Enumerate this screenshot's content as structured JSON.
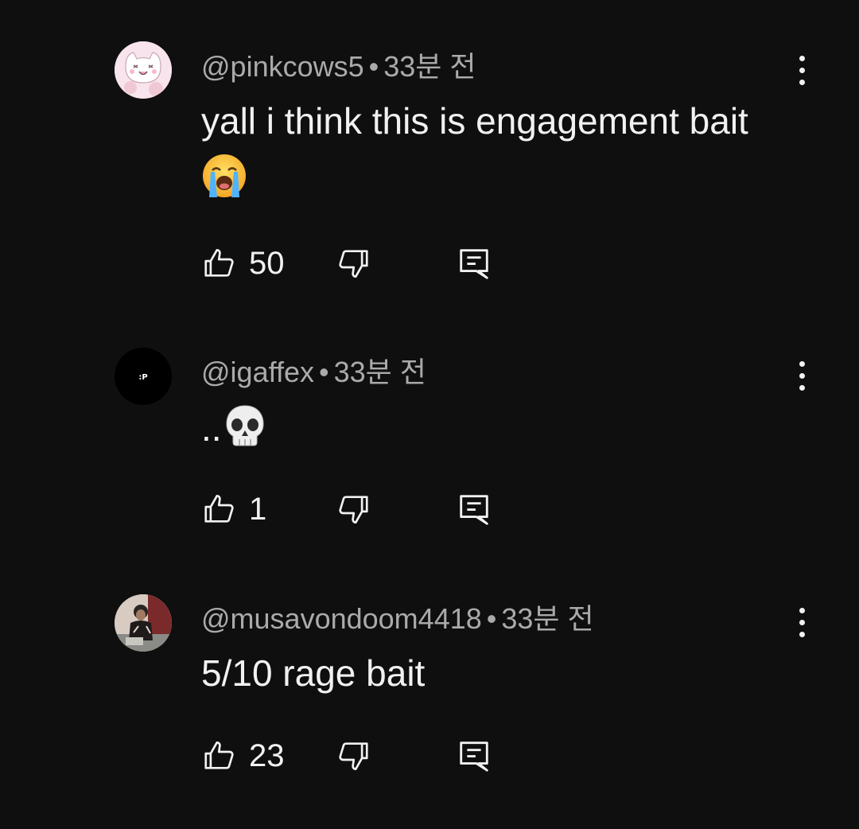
{
  "comments": [
    {
      "username": "@pinkcows5",
      "separator": "•",
      "time": "33분 전",
      "text": "yall i think this is engagement bait",
      "emoji": "loudly-crying-face",
      "likes": "50",
      "avatar": "pink-cat-avatar"
    },
    {
      "username": "@igaffex",
      "separator": "•",
      "time": "33분 전",
      "text": "..",
      "emoji": "skull",
      "likes": "1",
      "avatar_text": ":P"
    },
    {
      "username": "@musavondoom4418",
      "separator": "•",
      "time": "33분 전",
      "text": "5/10 rage bait",
      "likes": "23",
      "avatar": "person-photo-avatar"
    }
  ],
  "icons": {
    "like": "thumbs-up-icon",
    "dislike": "thumbs-down-icon",
    "reply": "reply-comment-icon",
    "more": "more-vertical-icon"
  },
  "colors": {
    "background": "#0f0f0f",
    "text": "#f1f1f1",
    "meta": "#aaaaaa"
  }
}
